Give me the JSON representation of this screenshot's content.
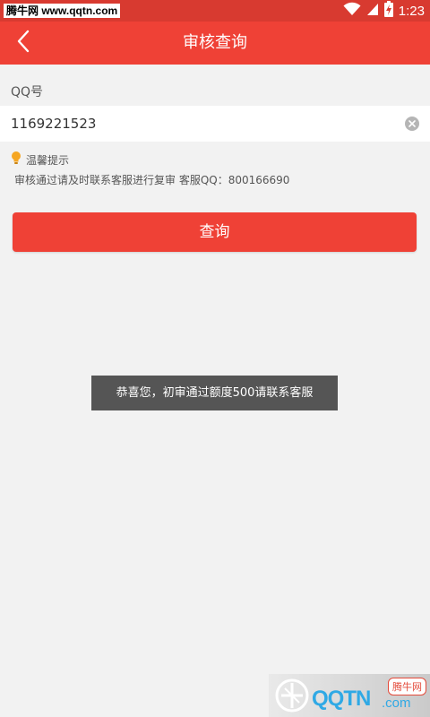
{
  "status_bar": {
    "watermark": "腾牛网 www.qqtn.com",
    "time": "1:23"
  },
  "header": {
    "title": "审核查询"
  },
  "form": {
    "qq_label": "QQ号",
    "qq_value": "1169221523"
  },
  "tips": {
    "title": "温馨提示",
    "text": "审核通过请及时联系客服进行复审 客服QQ：800166690"
  },
  "actions": {
    "query_label": "查询"
  },
  "toast": {
    "message": "恭喜您，初审通过额度500请联系客服"
  },
  "watermark": {
    "brand": "QQTN",
    "suffix": ".com",
    "badge": "腾牛网"
  },
  "colors": {
    "status_bar": "#d83a30",
    "app_bar": "#ef4136",
    "background": "#f2f2f2",
    "toast": "#555555",
    "tip_icon": "#f5a623"
  },
  "icons": {
    "back": "chevron-left-icon",
    "clear": "clear-circle-icon",
    "tip": "lightbulb-icon",
    "wifi": "wifi-icon",
    "signal": "signal-icon",
    "battery": "battery-charging-icon"
  }
}
